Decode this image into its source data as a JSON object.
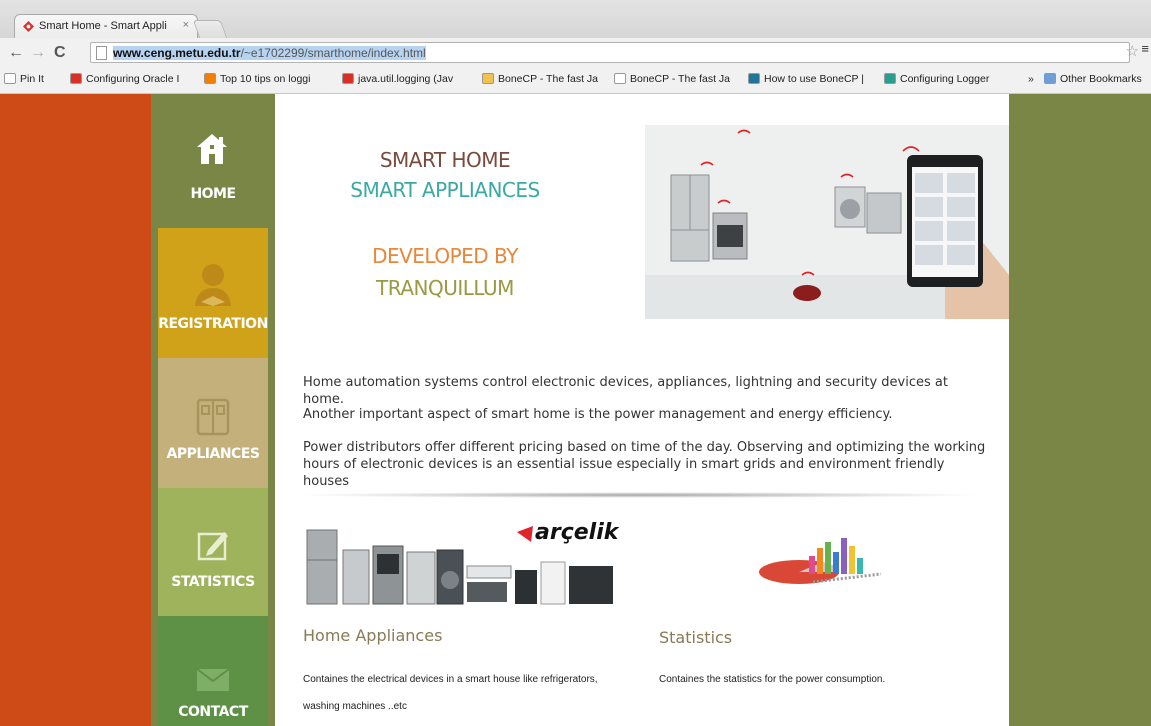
{
  "browser": {
    "tab_title": "Smart Home - Smart Appli",
    "tab_close": "×",
    "url_host": "www.ceng.metu.edu.tr",
    "url_path": "/~e1702299/smarthome/index.html",
    "bookmarks": [
      {
        "label": "Pin It",
        "icon": "page-icon",
        "color": "#ffffff"
      },
      {
        "label": "Configuring Oracle I",
        "icon": "oracle-icon",
        "color": "#d93025"
      },
      {
        "label": "Top 10 tips on loggi",
        "icon": "blogger-icon",
        "color": "#f57d00"
      },
      {
        "label": "java.util.logging (Jav",
        "icon": "oracle-icon",
        "color": "#d93025"
      },
      {
        "label": "BoneCP - The fast Ja",
        "icon": "bone-icon",
        "color": "#f2c14e"
      },
      {
        "label": "BoneCP - The fast Ja",
        "icon": "page-icon",
        "color": "#ffffff"
      },
      {
        "label": "How to use BoneCP |",
        "icon": "wordpress-icon",
        "color": "#21759b"
      },
      {
        "label": "Configuring Logger",
        "icon": "h-icon",
        "color": "#2a9d8f"
      }
    ],
    "overflow": "»",
    "other_bookmarks": "Other Bookmarks"
  },
  "colors": {
    "left_band": "#ce4a17",
    "olive": "#7a8645",
    "home_tile": "#7a8645",
    "registration_tile": "#cfa21a",
    "appliances_tile": "#c4b07a",
    "statistics_tile": "#9fb25c",
    "contact_tile": "#5e9146",
    "smart_home": "#7a4a3a",
    "smart_appliances": "#3aa9a6",
    "developed_by": "#e8873a",
    "tranquillum": "#9a9a44"
  },
  "nav": [
    {
      "label": "HOME",
      "icon": "home-icon"
    },
    {
      "label": "REGISTRATION",
      "icon": "user-icon"
    },
    {
      "label": "APPLIANCES",
      "icon": "appliances-icon"
    },
    {
      "label": "STATISTICS",
      "icon": "edit-icon"
    },
    {
      "label": "CONTACT",
      "icon": "mail-icon"
    }
  ],
  "hero": {
    "line1": "SMART HOME",
    "line2": "SMART APPLIANCES",
    "line3": "DEVELOPED BY",
    "line4": "TRANQUILLUM"
  },
  "intro": [
    "Home automation systems control electronic devices, appliances, lightning and security devices at home.",
    "Another important aspect of smart home is the power management and energy efficiency.",
    "Power distributors offer different pricing based on time of the day. Observing and optimizing the working hours of electronic devices is an essential issue especially in smart grids and environment friendly houses"
  ],
  "sections": {
    "appliances": {
      "title": "Home Appliances",
      "text": "Containes the electrical devices in a smart house like refrigerators, washing machines ..etc",
      "brand": "arçelik"
    },
    "statistics": {
      "title": "Statistics",
      "text": "Containes the statistics for the power consumption."
    }
  }
}
